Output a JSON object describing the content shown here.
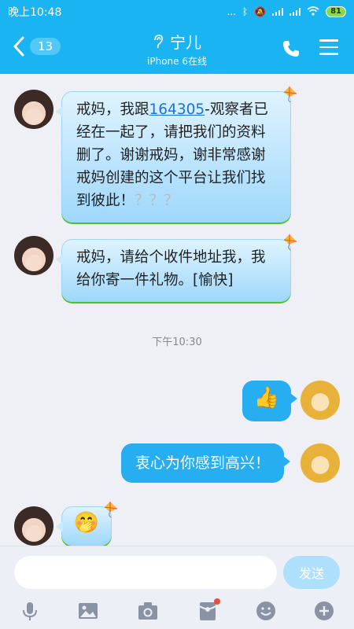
{
  "status_bar": {
    "time": "晚上10:48",
    "battery": "81",
    "dots": "..."
  },
  "header": {
    "back_badge": "13",
    "contact_name": "宁儿",
    "status": "iPhone 6在线"
  },
  "messages": [
    {
      "sender": "incoming",
      "text_before_link": "戒妈，我跟",
      "link": "164305",
      "text_after_link": "-观察者已经在一起了，请把我们的资料删了。谢谢戒妈，谢非常感谢戒妈创建的这个平台让我们找到彼此！",
      "trailing": "？？？"
    },
    {
      "sender": "incoming",
      "text": "戒妈，请给个收件地址我，我给你寄一件礼物。[愉快]"
    },
    {
      "sender": "timestamp",
      "text": "下午10:30"
    },
    {
      "sender": "outgoing",
      "emoji": "👍"
    },
    {
      "sender": "outgoing",
      "text": "衷心为你感到高兴！"
    },
    {
      "sender": "incoming",
      "emoji": "🤭"
    }
  ],
  "input": {
    "placeholder": "",
    "send_label": "发送"
  },
  "colors": {
    "accent": "#1ab4f2",
    "outgoing_bubble": "#26aef0",
    "incoming_bubble": "#bfe6fd"
  }
}
